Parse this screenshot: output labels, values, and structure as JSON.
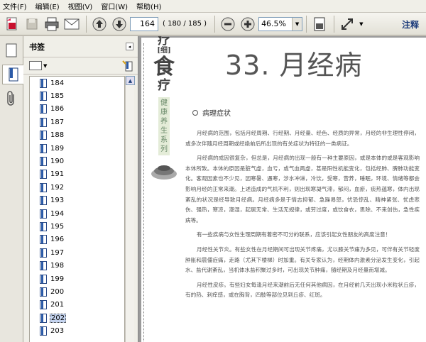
{
  "menu": [
    {
      "label": "文件",
      "key": "(F)"
    },
    {
      "label": "编辑",
      "key": "(E)"
    },
    {
      "label": "视图",
      "key": "(V)"
    },
    {
      "label": "窗口",
      "key": "(W)"
    },
    {
      "label": "帮助",
      "key": "(H)"
    }
  ],
  "toolbar": {
    "current_page": "164",
    "page_count": "( 180 / 185 )",
    "zoom": "46.5%",
    "annotate_label": "注释"
  },
  "panel": {
    "title": "书签"
  },
  "bookmarks": [
    {
      "label": "184"
    },
    {
      "label": "185"
    },
    {
      "label": "186"
    },
    {
      "label": "187"
    },
    {
      "label": "188"
    },
    {
      "label": "189"
    },
    {
      "label": "190"
    },
    {
      "label": "191"
    },
    {
      "label": "192"
    },
    {
      "label": "193"
    },
    {
      "label": "194"
    },
    {
      "label": "195"
    },
    {
      "label": "196"
    },
    {
      "label": "197"
    },
    {
      "label": "198"
    },
    {
      "label": "199"
    },
    {
      "label": "200"
    },
    {
      "label": "201"
    },
    {
      "label": "202",
      "selected": true
    },
    {
      "label": "203"
    }
  ],
  "document": {
    "side_title_top": "疗",
    "side_title_small": "[细]",
    "side_title_big": "食",
    "side_title_bottom": "疗",
    "side_vertical": "健康养生系列",
    "chapter_title": "33. 月经病",
    "section_heading": "病理症状",
    "paragraphs": [
      "月经病的范围，包括月经周期、行经期、月经量、经色、经质的异常，月经的非生理性停闭，或多次伴随月经周期或经绝前后所出现的有关症状为特征的一类病证。",
      "月经病的成因很复杂，但总是，月经病的出现一般有一种主要原因，或是本体的或是客观影响本体所致。本体的原因是脏气虚，血亏，或气血两虚，甚是阳性机能变化，包括经肺、脾肺功能变化。客观因素也不少见，因寒暑、遇寒，涉水冲淋，冷饮，受寒，营养，睡眠，环境、情绪等都会影响月经的正常来潮。上述造成的气机不利，则出现寒凝气滞，郁闷，血瘀，痰热蕴寒，体内出现紊乱的状况是经导致月经病。月经病多是于情志抑郁、急躁易怒，忧恐惊乱、精神紧张、忧虑悲伤、强热，寒凉，潮湿，起居无常、生活无规律，或劳过度，或饮食衣，思除、不来创伤，急性疾病等。",
      "有一些疾病与女性生理周期有着密不可分的联系，应该引起女性朋友的高度注意！",
      "月经性关节炎。有些女性在月经期间可出现关节疼痛，尤以膝关节痛为多见，可伴有关节轻度肿胀和晨僵症痛，走路（尤其下楼梯）时加重。有关专家认为，经期体内激素分泌发生变化，引起水、盐代谢紊乱，当机体水盐积聚过多时，可出现关节肿痛，随经期及月经量而增减。",
      "月经性皮疹。有些妇女每逢月经来潮前后无任何其他病因，在月经前几天出现小米粒状丘疹，有的热、刺痒感，或在胸背，四肢等部位见到丘疹、红斑。"
    ]
  }
}
